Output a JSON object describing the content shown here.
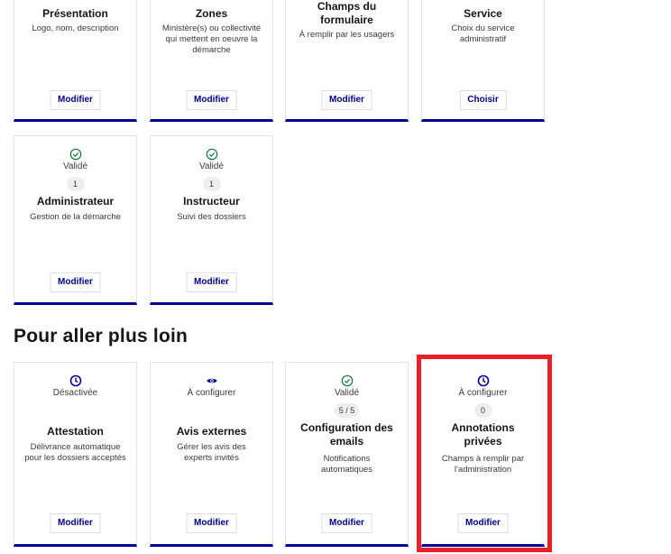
{
  "top_row": [
    {
      "title": "Présentation",
      "desc": "Logo, nom, description",
      "button": "Modifier"
    },
    {
      "title": "Zones",
      "desc": "Ministère(s) ou collectivité qui mettent en oeuvre la démarche",
      "button": "Modifier"
    },
    {
      "title": "Champs du formulaire",
      "desc": "À remplir par les usagers",
      "button": "Modifier"
    },
    {
      "title": "Service",
      "desc": "Choix du service administratif",
      "button": "Choisir"
    }
  ],
  "second_row": [
    {
      "status": "Validé",
      "status_icon": "check-circle-icon",
      "count": "1",
      "title": "Administrateur",
      "desc": "Gestion de la démarche",
      "button": "Modifier"
    },
    {
      "status": "Validé",
      "status_icon": "check-circle-icon",
      "count": "1",
      "title": "Instructeur",
      "desc": "Suivi des dossiers",
      "button": "Modifier"
    }
  ],
  "section_heading": "Pour aller plus loin",
  "more_row": [
    {
      "status": "Désactivée",
      "status_icon": "clock-icon",
      "title": "Attestation",
      "desc": "Délivrance automatique pour les dossiers acceptés",
      "button": "Modifier"
    },
    {
      "status": "À configurer",
      "status_icon": "eye-icon",
      "title": "Avis externes",
      "desc": "Gérer les avis des experts invités",
      "button": "Modifier"
    },
    {
      "status": "Validé",
      "status_icon": "check-circle-icon",
      "count": "5 / 5",
      "title": "Configuration des emails",
      "desc": "Notifications automatiques",
      "button": "Modifier"
    },
    {
      "status": "À configurer",
      "status_icon": "clock-icon",
      "count": "0",
      "title": "Annotations privées",
      "desc": "Champs à remplir par l’administration",
      "button": "Modifier"
    }
  ],
  "colors": {
    "accent": "#000091",
    "success": "#18753c",
    "highlight": "#e8202a"
  }
}
